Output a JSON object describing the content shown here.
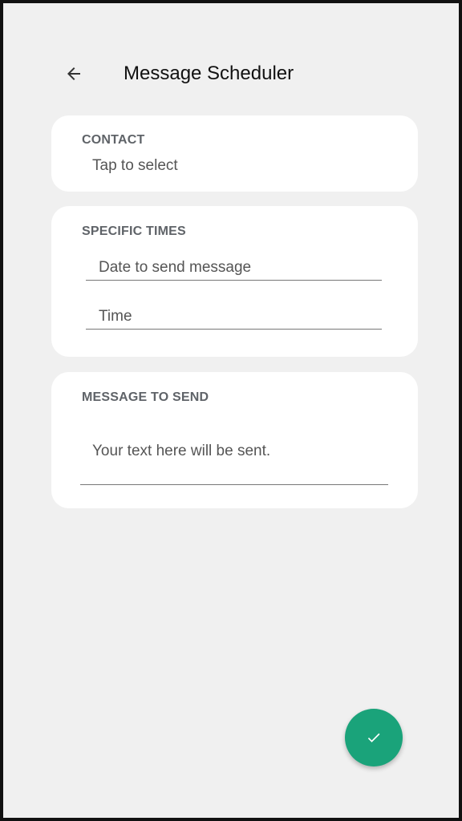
{
  "app_bar": {
    "title": "Message Scheduler",
    "back_icon": "arrow-left-icon"
  },
  "contact_card": {
    "label": "CONTACT",
    "value": "Tap to select"
  },
  "times_card": {
    "label": "SPECIFIC TIMES",
    "date_placeholder": "Date to send message",
    "time_placeholder": "Time"
  },
  "message_card": {
    "label": "MESSAGE TO SEND",
    "placeholder": "Your text here will be sent."
  },
  "fab": {
    "icon": "check-icon"
  },
  "colors": {
    "background": "#f0f0f0",
    "card": "#ffffff",
    "accent": "#1aa37a",
    "label": "#5f6368"
  }
}
